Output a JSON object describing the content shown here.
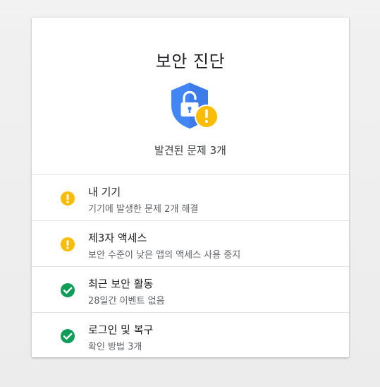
{
  "card": {
    "title": "보안 진단",
    "summary": "발견된 문제 3개",
    "shield_icon": "shield-unlocked-warning-icon"
  },
  "colors": {
    "shield_blue": "#4285f4",
    "warning_yellow": "#fbbc04",
    "ok_green": "#0f9d58",
    "text_primary": "#202124",
    "text_secondary": "#5f6368"
  },
  "items": [
    {
      "title": "내 기기",
      "subtitle": "기기에 발생한 문제 2개 해결",
      "status": "warning",
      "icon": "warning-icon"
    },
    {
      "title": "제3자 액세스",
      "subtitle": "보안 수준이 낮은 앱의 액세스 사용 중지",
      "status": "warning",
      "icon": "warning-icon"
    },
    {
      "title": "최근 보안 활동",
      "subtitle": "28일간 이벤트 없음",
      "status": "ok",
      "icon": "check-icon"
    },
    {
      "title": "로그인 및 복구",
      "subtitle": "확인 방법 3개",
      "status": "ok",
      "icon": "check-icon"
    }
  ]
}
